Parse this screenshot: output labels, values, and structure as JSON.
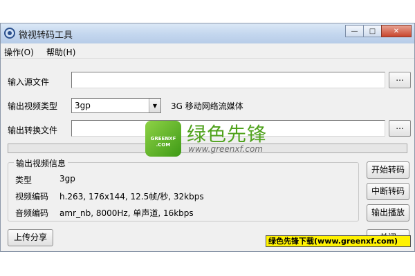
{
  "window": {
    "title": "微视转码工具",
    "controls": {
      "minimize": "—",
      "maximize": "□",
      "close": "✕"
    }
  },
  "menu": {
    "items": [
      "操作(O)",
      "帮助(H)"
    ]
  },
  "form": {
    "input_source_label": "输入源文件",
    "input_source_value": "",
    "browse_label": "...",
    "output_type_label": "输出视频类型",
    "output_type_value": "3gp",
    "output_type_desc": "3G 移动网络流媒体",
    "output_file_label": "输出转换文件",
    "output_file_value": ""
  },
  "progress": {
    "percent": 0
  },
  "info": {
    "title": "输出视频信息",
    "rows": [
      {
        "label": "类型",
        "value": "3gp"
      },
      {
        "label": "视频编码",
        "value": "h.263, 176x144, 12.5帧/秒, 32kbps"
      },
      {
        "label": "音频编码",
        "value": "amr_nb, 8000Hz, 单声道, 16kbps"
      }
    ]
  },
  "buttons": {
    "start": "开始转码",
    "stop": "中断转码",
    "play": "输出播放",
    "share": "上传分享",
    "partial": "关闭"
  },
  "watermark": {
    "logo_line1": "GREENXF",
    "logo_line2": ".COM",
    "name": "绿色先锋",
    "url": "www.greenxf.com"
  },
  "banner": {
    "text": "绿色先锋下载(www.greenxf.com)"
  },
  "icons": {
    "dropdown": "▼"
  },
  "colors": {
    "accent_green": "#4fa21c",
    "banner_yellow": "#fff200"
  }
}
